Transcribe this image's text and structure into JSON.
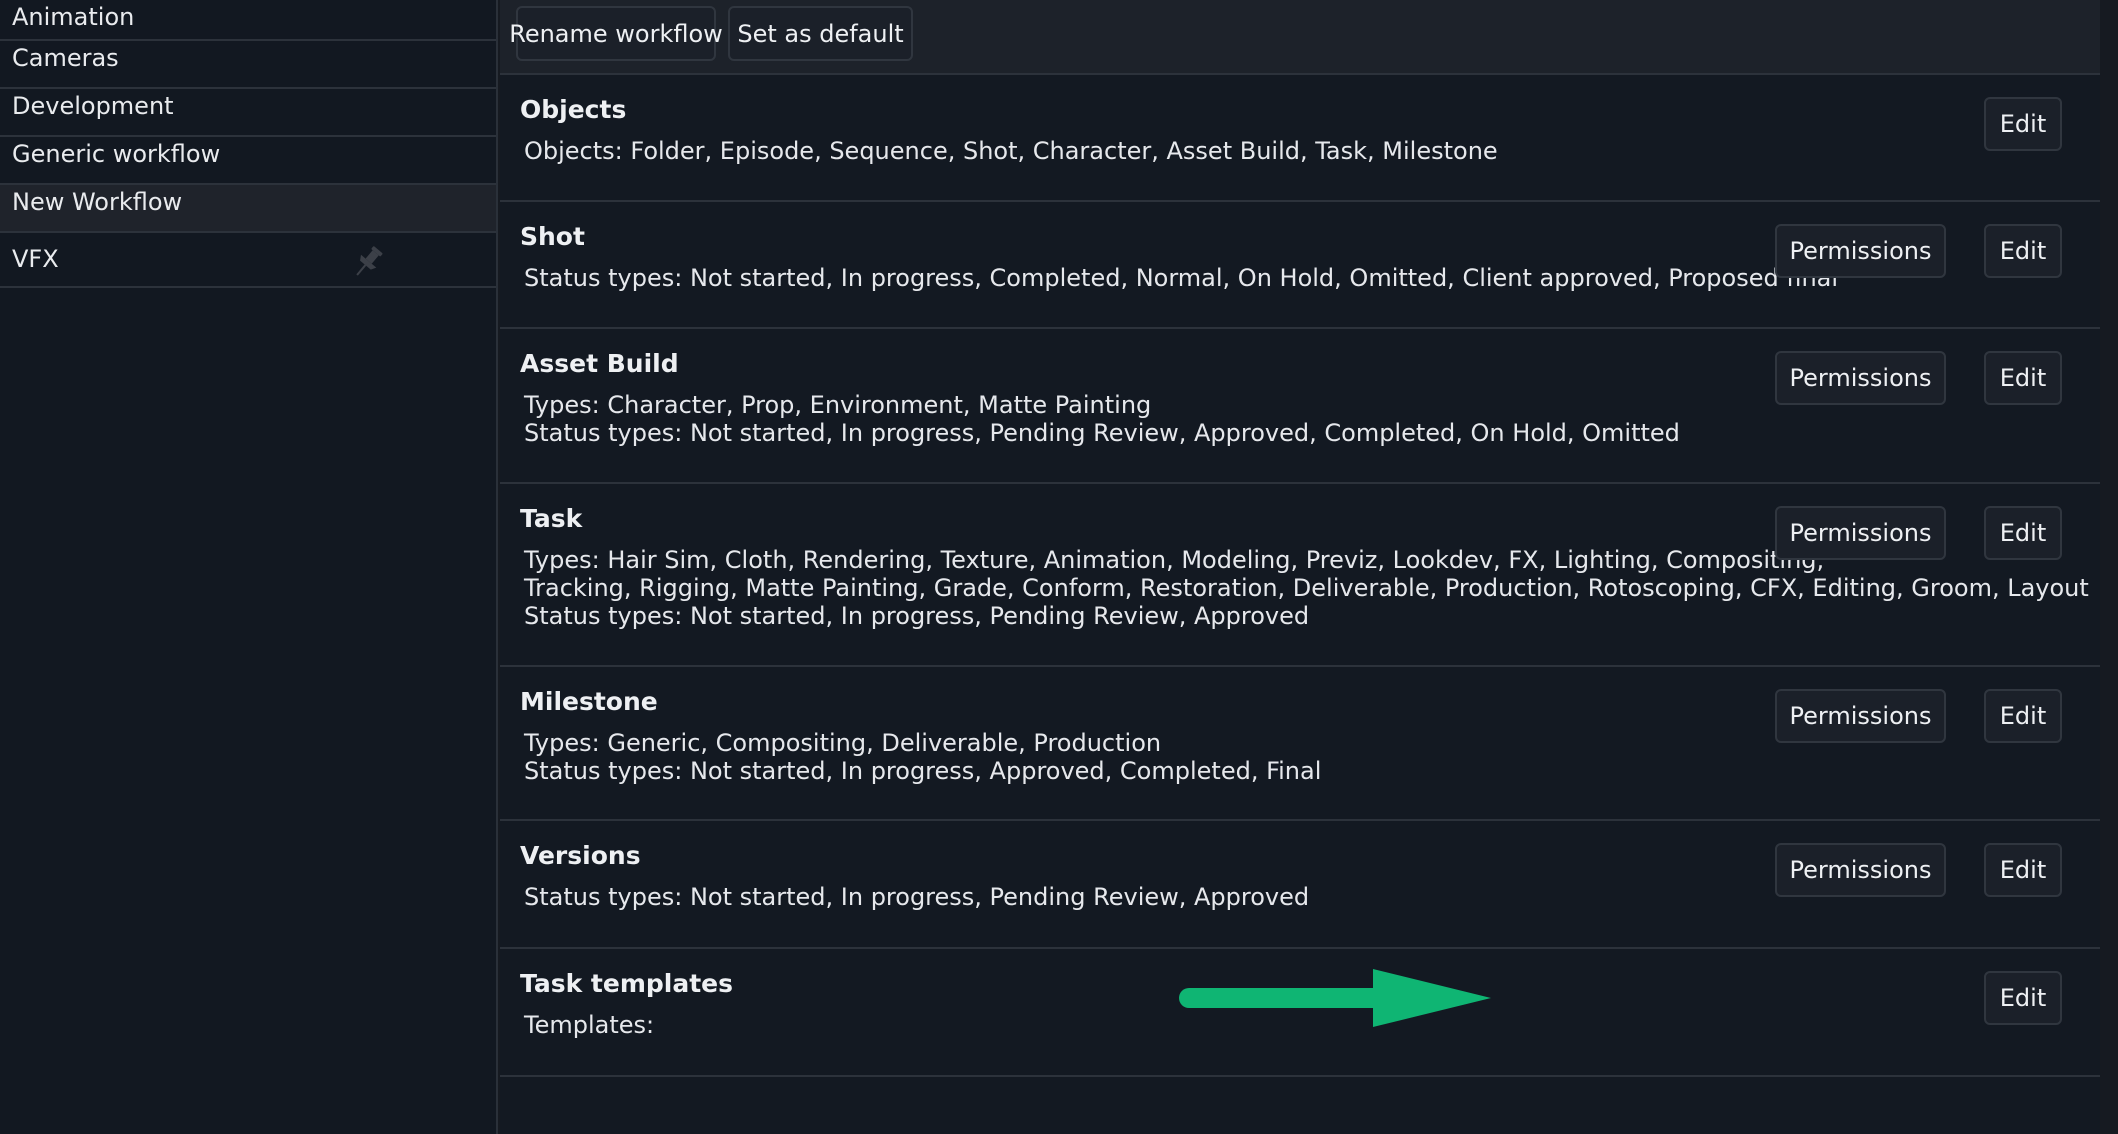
{
  "sidebar": {
    "items": [
      {
        "label": "Animation"
      },
      {
        "label": "Cameras"
      },
      {
        "label": "Development"
      },
      {
        "label": "Generic workflow"
      },
      {
        "label": "New Workflow",
        "selected": true
      },
      {
        "label": "VFX",
        "icon": "pin-icon"
      }
    ]
  },
  "toolbar": {
    "rename_label": "Rename workflow",
    "default_label": "Set as default"
  },
  "common": {
    "edit_label": "Edit",
    "permissions_label": "Permissions"
  },
  "sections": [
    {
      "title": "Objects",
      "lines": [
        "Objects: Folder, Episode, Sequence, Shot, Character, Asset Build, Task, Milestone"
      ]
    },
    {
      "title": "Shot",
      "lines": [
        "Status types: Not started, In progress, Completed, Normal, On Hold, Omitted, Client approved, Proposed final"
      ]
    },
    {
      "title": "Asset Build",
      "lines": [
        "Types: Character, Prop, Environment, Matte Painting",
        "Status types: Not started, In progress, Pending Review, Approved, Completed, On Hold, Omitted"
      ]
    },
    {
      "title": "Task",
      "lines": [
        "Types: Hair Sim, Cloth, Rendering, Texture, Animation, Modeling, Previz, Lookdev, FX, Lighting, Compositing,",
        "Tracking, Rigging, Matte Painting, Grade, Conform, Restoration, Deliverable, Production, Rotoscoping, CFX, Editing, Groom, Layout",
        "Status types: Not started, In progress, Pending Review, Approved"
      ]
    },
    {
      "title": "Milestone",
      "lines": [
        "Types: Generic, Compositing, Deliverable, Production",
        "Status types: Not started, In progress, Approved, Completed, Final"
      ]
    },
    {
      "title": "Versions",
      "lines": [
        "Status types: Not started, In progress, Pending Review, Approved"
      ]
    },
    {
      "title": "Task templates",
      "lines": [
        "Templates:"
      ]
    }
  ],
  "colors": {
    "arrow": "#0fb573"
  }
}
